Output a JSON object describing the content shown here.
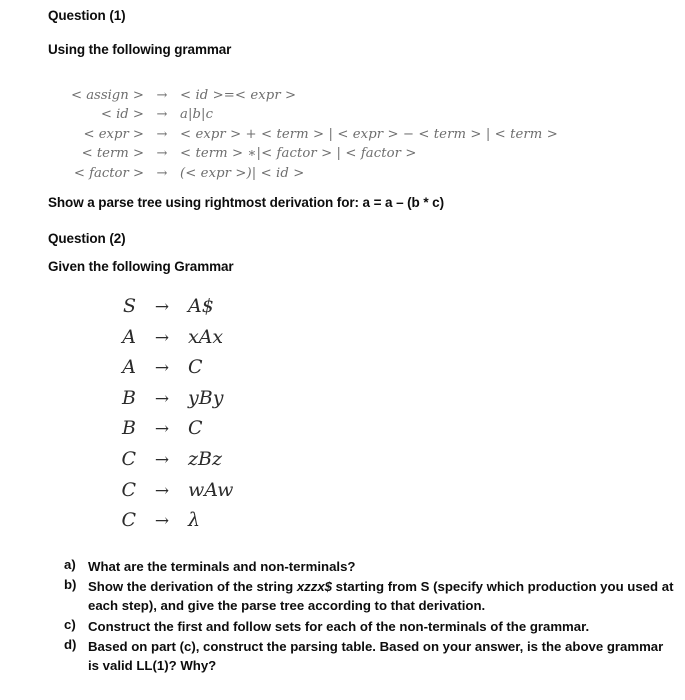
{
  "document": {
    "background_color": "#ffffff",
    "body_text_color": "#0d0d0d"
  },
  "question_one": {
    "title": "Question (1)",
    "intro": "Using the following grammar",
    "prompt": "Show a parse tree using rightmost derivation for: a = a – (b * c)",
    "grammar": {
      "text_color": "#6e6e6e",
      "arrow": "→",
      "productions": [
        {
          "lhs": "< assign >",
          "rhs": "< id >=< expr >"
        },
        {
          "lhs": "< id >",
          "rhs": "a|b|c"
        },
        {
          "lhs": "< expr >",
          "rhs": "< expr > + < term > | < expr > − < term > | < term >"
        },
        {
          "lhs": "< term >",
          "rhs": "< term > ∗|< factor > | < factor >"
        },
        {
          "lhs": "< factor >",
          "rhs": "(< expr >)| < id >"
        }
      ]
    }
  },
  "question_two": {
    "title": "Question (2)",
    "intro": "Given the following Grammar",
    "grammar": {
      "text_color": "#2b2b2b",
      "arrow": "→",
      "productions": [
        {
          "lhs": "S",
          "rhs": "A$"
        },
        {
          "lhs": "A",
          "rhs": "xAx"
        },
        {
          "lhs": "A",
          "rhs": "C"
        },
        {
          "lhs": "B",
          "rhs": "yBy"
        },
        {
          "lhs": "B",
          "rhs": "C"
        },
        {
          "lhs": "C",
          "rhs": "zBz"
        },
        {
          "lhs": "C",
          "rhs": "wAw"
        },
        {
          "lhs": "C",
          "rhs": "λ"
        }
      ]
    },
    "tasks": [
      {
        "marker": "a)",
        "text_before": "What are the terminals and non-terminals?",
        "emphasis": "",
        "text_after": ""
      },
      {
        "marker": "b)",
        "text_before": "Show the derivation of the string ",
        "emphasis": "xzzx$",
        "text_after": " starting from S (specify which production you used at each step), and give the parse tree according to that derivation."
      },
      {
        "marker": "c)",
        "text_before": "Construct the first and follow sets for each of the non-terminals of the grammar.",
        "emphasis": "",
        "text_after": ""
      },
      {
        "marker": "d)",
        "text_before": "Based on part (c), construct the parsing table. Based on your answer, is the above grammar is valid LL(1)? Why?",
        "emphasis": "",
        "text_after": ""
      }
    ]
  }
}
